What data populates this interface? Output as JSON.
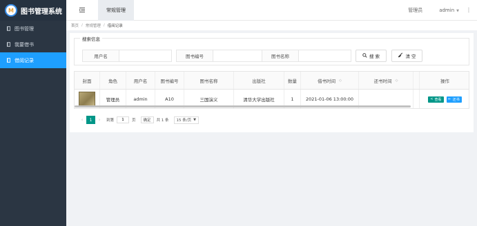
{
  "app": {
    "logo_text": "M",
    "title": "图书管理系统"
  },
  "sidebar": {
    "items": [
      {
        "label": "图书管理",
        "active": false
      },
      {
        "label": "我要借书",
        "active": false
      },
      {
        "label": "借阅记录",
        "active": true
      }
    ]
  },
  "header": {
    "fold_icon": "menu-fold-icon",
    "active_tab": "常规管理",
    "role_link": "管理员",
    "user_name": "admin",
    "caret_glyph": "▼",
    "more_glyph": "⋮"
  },
  "breadcrumb": {
    "items": [
      "首页",
      "常规管理",
      "借阅记录"
    ],
    "separator": "/"
  },
  "search": {
    "legend": "搜索信息",
    "fields": [
      {
        "label": "用户名",
        "value": ""
      },
      {
        "label": "图书编号",
        "value": ""
      },
      {
        "label": "图书名称",
        "value": ""
      }
    ],
    "search_button": "搜 索",
    "clear_button": "清 空"
  },
  "table": {
    "columns": [
      "封面",
      "角色",
      "用户名",
      "图书编号",
      "图书名称",
      "出版社",
      "数量",
      "借书时间",
      "还书时间",
      "操作"
    ],
    "rows": [
      {
        "role": "管理员",
        "username": "admin",
        "book_no": "A10",
        "book_name": "三国演义",
        "publisher": "清华大学出版社",
        "quantity": "1",
        "borrow_time": "2021-01-06 13:00:00",
        "return_time": "",
        "actions": [
          "查看",
          "还书"
        ]
      }
    ]
  },
  "pager": {
    "prev": "‹",
    "next": "›",
    "current_page": "1",
    "goto_label": "到第",
    "goto_value": "1",
    "page_unit": "页",
    "confirm": "确定",
    "total": "共 1 条",
    "page_size": "15 条/页"
  },
  "colors": {
    "sidebar": "#2b3643",
    "active_menu": "#1e9fff",
    "view_button": "#009688",
    "return_button": "#1e9fff",
    "pager_active": "#009688"
  }
}
